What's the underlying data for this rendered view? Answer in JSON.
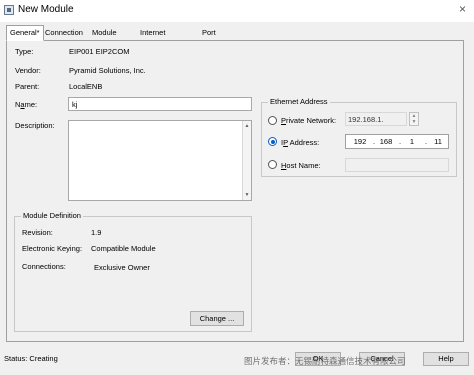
{
  "window": {
    "title": "New Module",
    "close_glyph": "×"
  },
  "tabs": [
    {
      "label": "General*"
    },
    {
      "label": "Connection"
    },
    {
      "label": "Module Info"
    },
    {
      "label": "Internet Protocol"
    },
    {
      "label": "Port Configuration"
    }
  ],
  "general": {
    "type_label": "Type:",
    "type_value": "EIP001 EIP2COM",
    "vendor_label": "Vendor:",
    "vendor_value": "Pyramid Solutions, Inc.",
    "parent_label": "Parent:",
    "parent_value": "LocalENB",
    "name_label_pre": "N",
    "name_label_u": "a",
    "name_label_post": "me:",
    "name_value": "kj",
    "description_label": "Description:",
    "description_value": ""
  },
  "ethernet": {
    "title": "Ethernet Address",
    "private_label_u": "P",
    "private_label_post": "rivate Network:",
    "private_value": "192.168.1.",
    "ip_label_pre": "I",
    "ip_label_u": "P",
    "ip_label_post": " Address:",
    "ip_segments": [
      "192",
      "168",
      "1",
      "11"
    ],
    "host_label_u": "H",
    "host_label_post": "ost Name:",
    "selected": "ip-address"
  },
  "module_definition": {
    "title": "Module Definition",
    "revision_label": "Revision:",
    "revision_value": "1.9",
    "keying_label": "Electronic Keying:",
    "keying_value": "Compatible Module",
    "connections_label": "Connections:",
    "connections_value": "Exclusive Owner",
    "change_button": "Change ..."
  },
  "footer": {
    "status": "Status:  Creating",
    "ok": "OK",
    "cancel": "Cancel",
    "help": "Help"
  },
  "watermark": "图片发布者：无锡耐特森通信技术有限公司"
}
